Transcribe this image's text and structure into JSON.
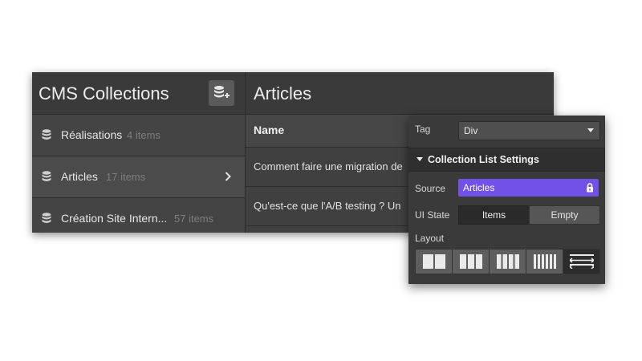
{
  "cms": {
    "title": "CMS Collections",
    "collections": [
      {
        "name": "Réalisations",
        "count": "4 items"
      },
      {
        "name": "Articles",
        "count": "17 items"
      },
      {
        "name": "Création Site Intern...",
        "count": "57 items"
      }
    ]
  },
  "articles": {
    "title": "Articles",
    "column_name": "Name",
    "rows": [
      "Comment faire une migration de",
      "Qu'est-ce que l'A/B testing ? Un"
    ]
  },
  "settings": {
    "tag_label": "Tag",
    "tag_value": "Div",
    "section_title": "Collection List Settings",
    "source_label": "Source",
    "source_value": "Articles",
    "ui_state_label": "UI State",
    "ui_state_options": [
      "Items",
      "Empty"
    ],
    "ui_state_selected": "Items",
    "layout_label": "Layout",
    "layout_options": [
      "2-columns-icon",
      "3-columns-icon",
      "4-columns-icon",
      "6-columns-icon",
      "list-rows-icon"
    ],
    "layout_selected": "list-rows-icon"
  },
  "colors": {
    "source_accent": "#7151e8",
    "panel_bg": "#3c3c3c"
  }
}
